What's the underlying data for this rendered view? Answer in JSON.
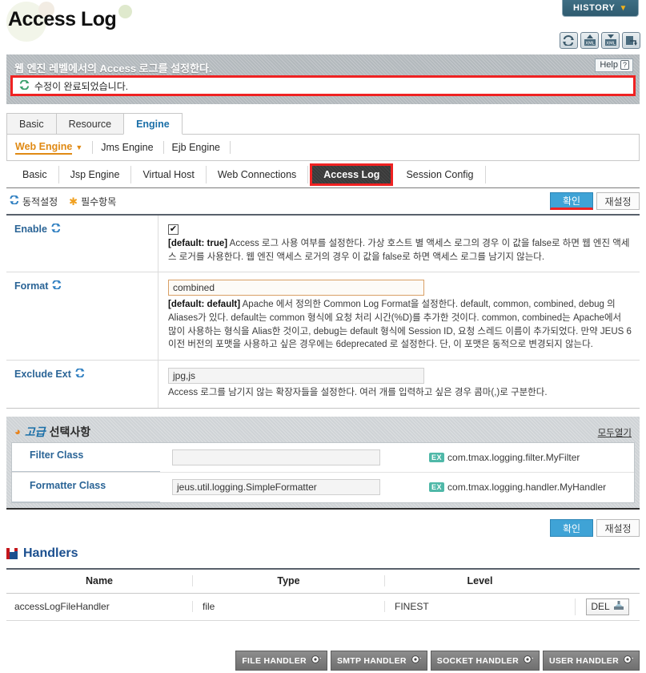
{
  "header": {
    "title": "Access Log",
    "history_label": "HISTORY",
    "chevron": "▼",
    "icons": [
      {
        "name": "refresh-icon",
        "title": "refresh"
      },
      {
        "name": "xml-upload-icon",
        "title": "XML"
      },
      {
        "name": "xml-download-icon",
        "title": "XML"
      },
      {
        "name": "apply-icon",
        "title": "apply"
      }
    ]
  },
  "desc": {
    "text": "웹 엔진 레벨에서의 Access 로그를 설정한다.",
    "help_label": "Help",
    "help_mark": "?",
    "message": "수정이 완료되었습니다."
  },
  "tabs1": [
    {
      "label": "Basic",
      "active": false
    },
    {
      "label": "Resource",
      "active": false
    },
    {
      "label": "Engine",
      "active": true
    }
  ],
  "tabs2": [
    {
      "label": "Web Engine",
      "active": true,
      "caret": "▼"
    },
    {
      "label": "Jms Engine",
      "active": false,
      "caret": ""
    },
    {
      "label": "Ejb Engine",
      "active": false,
      "caret": ""
    }
  ],
  "tabs3": [
    {
      "label": "Basic",
      "active": false
    },
    {
      "label": "Jsp Engine",
      "active": false
    },
    {
      "label": "Virtual Host",
      "active": false
    },
    {
      "label": "Web Connections",
      "active": false
    },
    {
      "label": "Access Log",
      "active": true
    },
    {
      "label": "Session Config",
      "active": false
    }
  ],
  "legend": {
    "dynamic": "동적설정",
    "required": "필수항목"
  },
  "buttons": {
    "confirm": "확인",
    "reset": "재설정"
  },
  "form": {
    "rows": [
      {
        "key": "Enable",
        "type": "checkbox",
        "checked": true,
        "check_glyph": "✔",
        "default_label": "[default: true]",
        "desc": "Access 로그 사용 여부를 설정한다. 가상 호스트 별 액세스 로그의 경우 이 값을 false로 하면 웹 엔진 액세스 로거를 사용한다. 웹 엔진 액세스 로거의 경우 이 값을 false로 하면 액세스 로그를 남기지 않는다."
      },
      {
        "key": "Format",
        "type": "text",
        "value": "combined",
        "highlight": true,
        "default_label": "[default: default]",
        "desc": "Apache 에서 정의한 Common Log Format을 설정한다. default, common, combined, debug 의 Aliases가 있다. default는 common 형식에 요청 처리 시간(%D)를 추가한 것이다. common, combined는 Apache에서 많이 사용하는 형식을 Alias한 것이고, debug는 default 형식에 Session ID, 요청 스레드 이름이 추가되었다. 만약 JEUS 6 이전 버전의 포맷을 사용하고 싶은 경우에는 6deprecated 로 설정한다. 단, 이 포맷은 동적으로 변경되지 않는다."
      },
      {
        "key": "Exclude Ext",
        "type": "text",
        "value": "jpg,js",
        "highlight": false,
        "default_label": "",
        "desc": "Access 로그를 남기지 않는 확장자들을 설정한다. 여러 개를 입력하고 싶은 경우 콤마(,)로 구분한다."
      }
    ]
  },
  "advanced": {
    "title_em": "고급",
    "title_rest": "선택사항",
    "open_all": "모두열기",
    "rows": [
      {
        "label": "Filter Class",
        "value": "",
        "ex_badge": "EX",
        "hint": "com.tmax.logging.filter.MyFilter"
      },
      {
        "label": "Formatter Class",
        "value": "jeus.util.logging.SimpleFormatter",
        "ex_badge": "EX",
        "hint": "com.tmax.logging.handler.MyHandler"
      }
    ]
  },
  "handlers": {
    "section_title": "Handlers",
    "columns": [
      "Name",
      "Type",
      "Level"
    ],
    "rows": [
      {
        "name": "accessLogFileHandler",
        "type": "file",
        "level": "FINEST",
        "delete_label": "DEL"
      }
    ],
    "footer_buttons": [
      {
        "label": "FILE HANDLER"
      },
      {
        "label": "SMTP HANDLER"
      },
      {
        "label": "SOCKET HANDLER"
      },
      {
        "label": "USER HANDLER"
      }
    ]
  },
  "colors": {
    "accent_blue": "#2a6496",
    "alert_red": "#ef2222",
    "orange": "#e08a14",
    "teal": "#4fb8a8",
    "primary_btn": "#3fa3d6"
  }
}
